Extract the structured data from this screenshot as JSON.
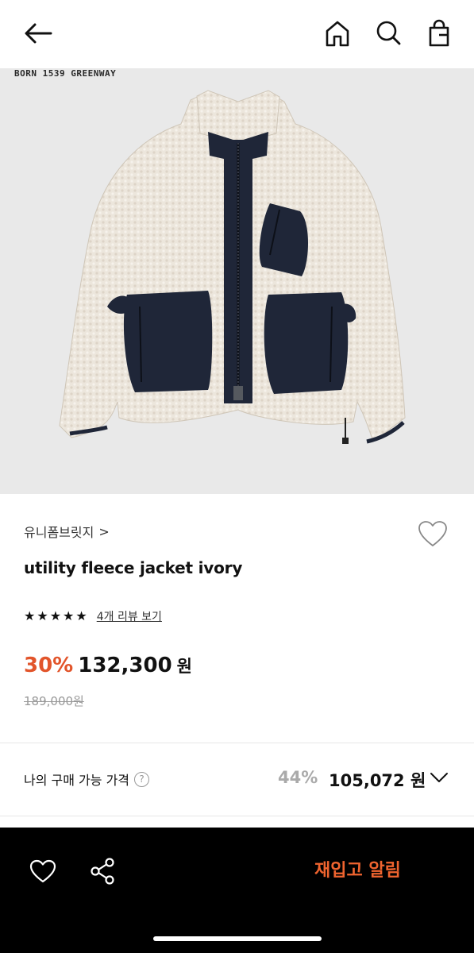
{
  "header": {
    "back_icon": "arrow-left-icon",
    "home_icon": "home-icon",
    "search_icon": "search-icon",
    "bag_icon": "shopping-bag-icon"
  },
  "hero": {
    "brand_mark": "BORN 1539 GREENWAY",
    "image_subject": "ivory fleece jacket with navy pockets",
    "background_color": "#e9e9e9"
  },
  "product": {
    "brand": "유니폼브릿지",
    "brand_chevron": ">",
    "title": "utility fleece jacket ivory",
    "rating_stars": 5,
    "star_glyph": "★",
    "review_link": "4개 리뷰 보기",
    "discount": "30%",
    "price": "132,300",
    "price_unit": "원",
    "original_price": "189,000원"
  },
  "my_price": {
    "label": "나의 구매 가능 가격",
    "help_glyph": "?",
    "discount": "44%",
    "price": "105,072 원"
  },
  "bottom_bar": {
    "like_icon": "heart-outline-icon",
    "share_icon": "share-icon",
    "restock_label": "재입고 알림"
  },
  "colors": {
    "accent": "#e2552b",
    "restock_text": "#f0642f",
    "muted": "#999999"
  }
}
